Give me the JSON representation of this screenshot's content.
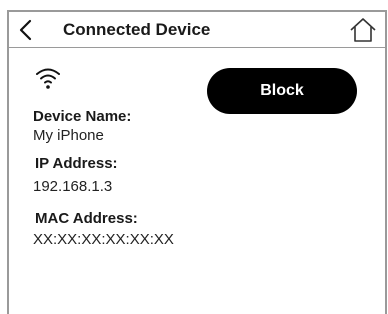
{
  "header": {
    "title": "Connected Device"
  },
  "device": {
    "name_label": "Device Name:",
    "name_value": "My iPhone",
    "ip_label": "IP Address:",
    "ip_value": "192.168.1.3",
    "mac_label": "MAC Address:",
    "mac_value": "XX:XX:XX:XX:XX:XX"
  },
  "actions": {
    "block_label": "Block"
  },
  "icons": {
    "back": "chevron-left-icon",
    "home": "home-icon",
    "wifi": "wifi-icon"
  }
}
